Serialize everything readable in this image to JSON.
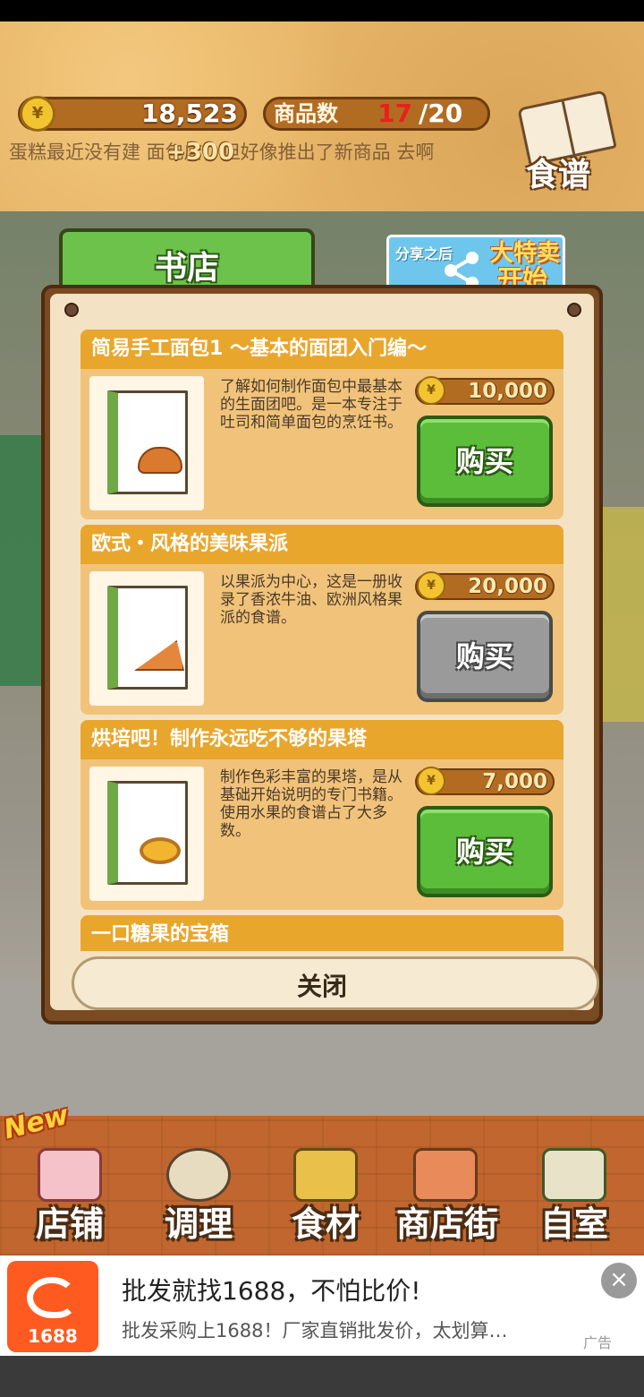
{
  "hud": {
    "coins": "18,523",
    "coin_bonus": "+300",
    "goods_label": "商品数",
    "goods_count": "17",
    "goods_max": "/20",
    "recipe_label": "食谱",
    "ticker": "蛋糕最近没有建 面包店，但好像推出了新商品 去啊"
  },
  "modal": {
    "tab_title": "书店",
    "share_sub": "分享之后",
    "share_main_1": "大特卖",
    "share_main_2": "开始",
    "close_label": "关闭",
    "items": [
      {
        "title": "简易手工面包1 ～基本的面团入门编～",
        "desc": "了解如何制作面包中最基本的生面团吧。是一本专注于吐司和简单面包的烹饪书。",
        "price": "10,000",
        "buy_label": "购买",
        "enabled": true,
        "thumb": "bread"
      },
      {
        "title": "欧式・风格的美味果派",
        "desc": "以果派为中心，这是一册收录了香浓牛油、欧洲风格果派的食谱。",
        "price": "20,000",
        "buy_label": "购买",
        "enabled": false,
        "thumb": "pie"
      },
      {
        "title": "烘培吧！制作永远吃不够的果塔",
        "desc": "制作色彩丰富的果塔，是从基础开始说明的专门书籍。使用水果的食谱占了大多数。",
        "price": "7,000",
        "buy_label": "购买",
        "enabled": true,
        "thumb": "tart"
      },
      {
        "title": "一口糖果的宝箱"
      }
    ]
  },
  "nav": {
    "new_badge": "New",
    "items": [
      {
        "label": "店铺",
        "icon": "cake-icon"
      },
      {
        "label": "调理",
        "icon": "mixing-bowl-icon"
      },
      {
        "label": "食材",
        "icon": "flour-sack-icon"
      },
      {
        "label": "商店街",
        "icon": "shop-street-icon"
      },
      {
        "label": "自室",
        "icon": "staff-room-icon"
      }
    ]
  },
  "ad": {
    "logo_text": "1688",
    "title": "批发就找1688，不怕比价!",
    "subtitle": "批发采购上1688！厂家直销批发价，太划算…",
    "tag": "广告",
    "close_icon": "×"
  },
  "colors": {
    "accent_green": "#5bbd3a",
    "header_orange": "#e9a62d",
    "ad_brand": "#ff5a1f"
  }
}
